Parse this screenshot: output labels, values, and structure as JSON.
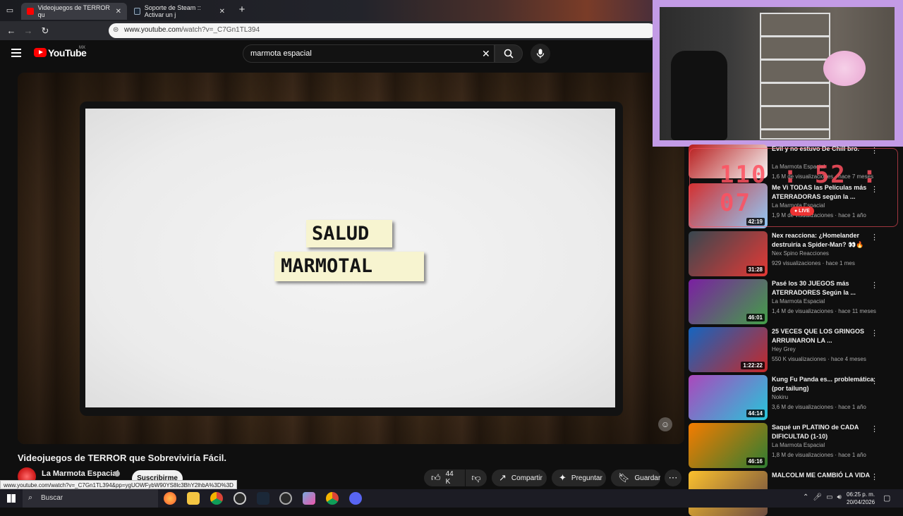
{
  "browser": {
    "tabs": [
      {
        "title": "Videojuegos de TERROR qu",
        "active": true
      },
      {
        "title": "Soporte de Steam :: Activar un j",
        "active": false
      }
    ],
    "new_tab": "+",
    "url_host": "www.youtube.com",
    "url_path": "/watch?v=_C7Gn1TL394",
    "status_url": "www.youtube.com/watch?v=_C7Gn1TL394&pp=ygUOWFybW90YS8lc3BhY2lhbA%3D%3D"
  },
  "youtube": {
    "logo_text": "YouTube",
    "country": "MX",
    "search_value": "marmota espacial",
    "video": {
      "card_line1": "SALUD",
      "card_line2": "MARMOTAL",
      "title": "Videojuegos de TERROR que Sobreviviría Fácil.",
      "channel": "La Marmota Espacial",
      "subscribe": "Suscribirme",
      "likes": "44 K",
      "share": "Compartir",
      "ask": "Preguntar",
      "save": "Guardar"
    },
    "recommendations": [
      {
        "title": "Evil y no estuvo De Chill bro.",
        "channel": "La Marmota Espacial",
        "meta": "1,6 M de visualizaciones · hace 7 meses",
        "duration": "",
        "colors": [
          "#b71c1c",
          "#f5f5f5"
        ]
      },
      {
        "title": "Me Vi TODAS las Películas más ATERRADORAS según la ...",
        "channel": "La Marmota Espacial",
        "meta": "1,9 M de visualizaciones · hace 1 año",
        "duration": "42:19",
        "colors": [
          "#d32f2f",
          "#90caf9"
        ]
      },
      {
        "title": "Nex reacciona: ¿Homelander destruiría a Spider-Man? 👀🔥",
        "channel": "Nex Spino Reacciones",
        "meta": "929 visualizaciones · hace 1 mes",
        "duration": "31:28",
        "colors": [
          "#37474f",
          "#e53935"
        ]
      },
      {
        "title": "Pasé los 30 JUEGOS más ATERRADORES Según la ...",
        "channel": "La Marmota Espacial",
        "meta": "1,4 M de visualizaciones · hace 11 meses",
        "duration": "46:01",
        "colors": [
          "#7b1fa2",
          "#43a047"
        ]
      },
      {
        "title": "25 VECES QUE LOS GRINGOS ARRUINARON LA ...",
        "channel": "Hey Grey",
        "meta": "550 K visualizaciones · hace 4 meses",
        "duration": "1:22:22",
        "colors": [
          "#1565c0",
          "#c62828"
        ]
      },
      {
        "title": "Kung Fu Panda es... problemática (por tailung)",
        "channel": "Nokiru",
        "meta": "3,6 M de visualizaciones · hace 1 año",
        "duration": "44:14",
        "colors": [
          "#ab47bc",
          "#26c6da"
        ]
      },
      {
        "title": "Saqué un PLATINO de CADA DIFICULTAD (1-10)",
        "channel": "La Marmota Espacial",
        "meta": "1,8 M de visualizaciones · hace 1 año",
        "duration": "46:16",
        "colors": [
          "#f57c00",
          "#2e7d32"
        ]
      },
      {
        "title": "MALCOLM ME CAMBIÓ LA VIDA",
        "channel": "",
        "meta": "",
        "duration": "",
        "colors": [
          "#fbc02d",
          "#6d4c41"
        ]
      }
    ],
    "live_badge": "● LIVE"
  },
  "overlay": {
    "timer": "110 : 52 : 07"
  },
  "taskbar": {
    "search_placeholder": "Buscar",
    "time": "06:25 p. m.",
    "date": "20/04/2026"
  }
}
